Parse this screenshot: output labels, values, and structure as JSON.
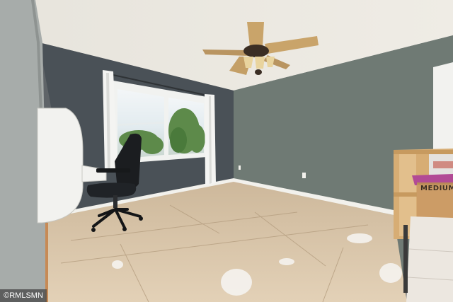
{
  "photo": {
    "box_label": "MEDIUM",
    "watermark": "©RMLSMN"
  },
  "colors": {
    "ceiling": "#ece9e1",
    "wall_gray_green": "#6f7a74",
    "wall_dark_gray": "#4a5157",
    "left_wall": "#a7acaa",
    "subfloor": "#d9c6ac",
    "baseboard": "#f2f1ec",
    "curtain": "#f4f4f2",
    "fan_blade": "#c9a46a",
    "shelf_wood": "#d7ad74"
  }
}
